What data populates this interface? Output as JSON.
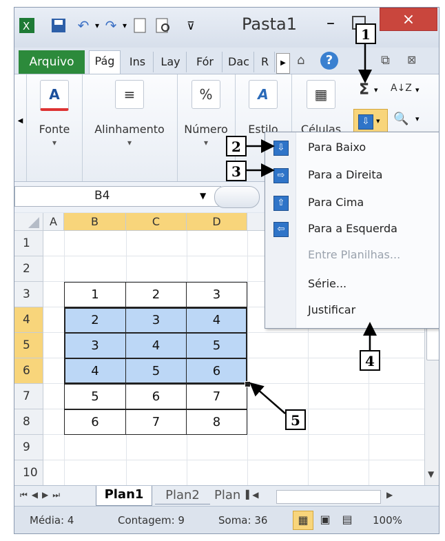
{
  "window": {
    "title": "Pasta1",
    "close_symbol": "×",
    "minimize_symbol": "–"
  },
  "tabs": [
    {
      "label": "Arquivo"
    },
    {
      "label": "Pág"
    },
    {
      "label": "Ins"
    },
    {
      "label": "Lay"
    },
    {
      "label": "Fór"
    },
    {
      "label": "Dac"
    },
    {
      "label": "R"
    }
  ],
  "ribbon": {
    "groups": [
      {
        "label": "Fonte",
        "icon": "A"
      },
      {
        "label": "Alinhamento",
        "icon": "≡"
      },
      {
        "label": "Número",
        "icon": "%"
      },
      {
        "label": "Estilo",
        "icon": "A"
      },
      {
        "label": "Células",
        "icon": "▦"
      }
    ],
    "sigma": "Σ",
    "sort": "A↓Z",
    "find": "🔍"
  },
  "namebox": {
    "value": "B4"
  },
  "grid": {
    "columns": [
      "A",
      "B",
      "C",
      "D"
    ],
    "rows": [
      "1",
      "2",
      "3",
      "4",
      "5",
      "6",
      "7",
      "8",
      "9",
      "10"
    ],
    "values": [
      [
        "1",
        "2",
        "3"
      ],
      [
        "2",
        "3",
        "4"
      ],
      [
        "3",
        "4",
        "5"
      ],
      [
        "4",
        "5",
        "6"
      ],
      [
        "5",
        "6",
        "7"
      ],
      [
        "6",
        "7",
        "8"
      ]
    ]
  },
  "menu": {
    "items": [
      {
        "label": "Para Baixo",
        "icon": "down-arrow-icon",
        "enabled": true
      },
      {
        "label": "Para a Direita",
        "icon": "right-arrow-icon",
        "enabled": true
      },
      {
        "label": "Para Cima",
        "icon": "up-arrow-icon",
        "enabled": true
      },
      {
        "label": "Para a Esquerda",
        "icon": "left-arrow-icon",
        "enabled": true
      },
      {
        "label": "Entre Planilhas...",
        "enabled": false
      },
      {
        "label": "Série...",
        "enabled": true
      },
      {
        "label": "Justificar",
        "enabled": true
      }
    ]
  },
  "sheets": {
    "tabs": [
      "Plan1",
      "Plan2",
      "Plan"
    ]
  },
  "status": {
    "media": "Média: 4",
    "contagem": "Contagem: 9",
    "soma": "Soma: 36",
    "zoom": "100%"
  },
  "callouts": [
    "1",
    "2",
    "3",
    "4",
    "5"
  ]
}
